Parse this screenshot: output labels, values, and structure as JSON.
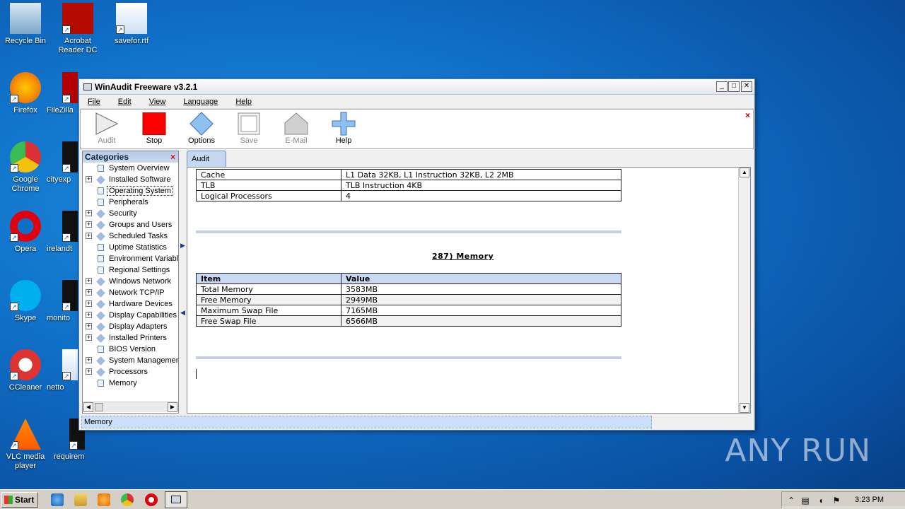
{
  "desktop": {
    "icons": [
      {
        "label": "Recycle Bin",
        "icon": "recycle-bin-icon"
      },
      {
        "label": "Acrobat Reader DC",
        "icon": "acrobat-icon"
      },
      {
        "label": "savefor.rtf",
        "icon": "word-document-icon"
      },
      {
        "label": "Firefox",
        "icon": "firefox-icon"
      },
      {
        "label": "FileZilla",
        "icon": "filezilla-icon"
      },
      {
        "label": "Google Chrome",
        "icon": "chrome-icon"
      },
      {
        "label": "cityexp",
        "icon": "file-icon"
      },
      {
        "label": "Opera",
        "icon": "opera-icon"
      },
      {
        "label": "irelandt",
        "icon": "file-icon"
      },
      {
        "label": "Skype",
        "icon": "skype-icon"
      },
      {
        "label": "monito",
        "icon": "file-icon"
      },
      {
        "label": "CCleaner",
        "icon": "ccleaner-icon"
      },
      {
        "label": "netto",
        "icon": "word-document-icon"
      },
      {
        "label": "VLC media player",
        "icon": "vlc-icon"
      },
      {
        "label": "requirement...",
        "icon": "file-icon"
      }
    ],
    "watermark": "ANY RUN"
  },
  "window": {
    "title": "WinAudit Freeware v3.2.1",
    "controls": {
      "minimize": "_",
      "maximize": "□",
      "close": "✕"
    },
    "menu": [
      "File",
      "Edit",
      "View",
      "Language",
      "Help"
    ],
    "toolbar": [
      {
        "label": "Audit",
        "icon": "play-icon",
        "enabled": false
      },
      {
        "label": "Stop",
        "icon": "stop-icon",
        "enabled": true
      },
      {
        "label": "Options",
        "icon": "options-diamond-icon",
        "enabled": true
      },
      {
        "label": "Save",
        "icon": "save-icon",
        "enabled": false
      },
      {
        "label": "E-Mail",
        "icon": "email-house-icon",
        "enabled": false
      },
      {
        "label": "Help",
        "icon": "help-plus-icon",
        "enabled": true
      }
    ],
    "toolbar_close": "×",
    "categories": {
      "header": "Categories",
      "close": "×",
      "items": [
        {
          "label": "System Overview",
          "expandable": false,
          "icon": "doc"
        },
        {
          "label": "Installed Software",
          "expandable": true,
          "icon": "diamond"
        },
        {
          "label": "Operating System",
          "expandable": false,
          "icon": "doc",
          "selected": true
        },
        {
          "label": "Peripherals",
          "expandable": false,
          "icon": "doc"
        },
        {
          "label": "Security",
          "expandable": true,
          "icon": "diamond"
        },
        {
          "label": "Groups and Users",
          "expandable": true,
          "icon": "diamond"
        },
        {
          "label": "Scheduled Tasks",
          "expandable": true,
          "icon": "diamond"
        },
        {
          "label": "Uptime Statistics",
          "expandable": false,
          "icon": "doc"
        },
        {
          "label": "Environment Variables",
          "expandable": false,
          "icon": "doc"
        },
        {
          "label": "Regional Settings",
          "expandable": false,
          "icon": "doc"
        },
        {
          "label": "Windows Network",
          "expandable": true,
          "icon": "diamond"
        },
        {
          "label": "Network TCP/IP",
          "expandable": true,
          "icon": "diamond"
        },
        {
          "label": "Hardware Devices",
          "expandable": true,
          "icon": "diamond"
        },
        {
          "label": "Display Capabilities",
          "expandable": true,
          "icon": "diamond"
        },
        {
          "label": "Display Adapters",
          "expandable": true,
          "icon": "diamond"
        },
        {
          "label": "Installed Printers",
          "expandable": true,
          "icon": "diamond"
        },
        {
          "label": "BIOS Version",
          "expandable": false,
          "icon": "doc"
        },
        {
          "label": "System Management",
          "expandable": true,
          "icon": "diamond"
        },
        {
          "label": "Processors",
          "expandable": true,
          "icon": "diamond"
        },
        {
          "label": "Memory",
          "expandable": false,
          "icon": "doc"
        }
      ]
    },
    "tab": "Audit",
    "report": {
      "top_table": [
        [
          "Cache",
          "L1 Data 32KB, L1 Instruction 32KB, L2 2MB"
        ],
        [
          "TLB",
          "TLB Instruction 4KB"
        ],
        [
          "Logical Processors",
          "4"
        ]
      ],
      "memory_title": "287) Memory",
      "memory_headers": [
        "Item",
        "Value"
      ],
      "memory_rows": [
        [
          "Total Memory",
          "3583MB"
        ],
        [
          "Free Memory",
          "2949MB"
        ],
        [
          "Maximum Swap File",
          "7165MB"
        ],
        [
          "Free Swap File",
          "6566MB"
        ]
      ]
    },
    "status": "Memory"
  },
  "taskbar": {
    "start": "Start",
    "pinned": [
      "ie-icon",
      "explorer-icon",
      "media-player-icon",
      "chrome-icon",
      "opera-icon",
      "winaudit-icon"
    ],
    "clock": "3:23 PM"
  }
}
